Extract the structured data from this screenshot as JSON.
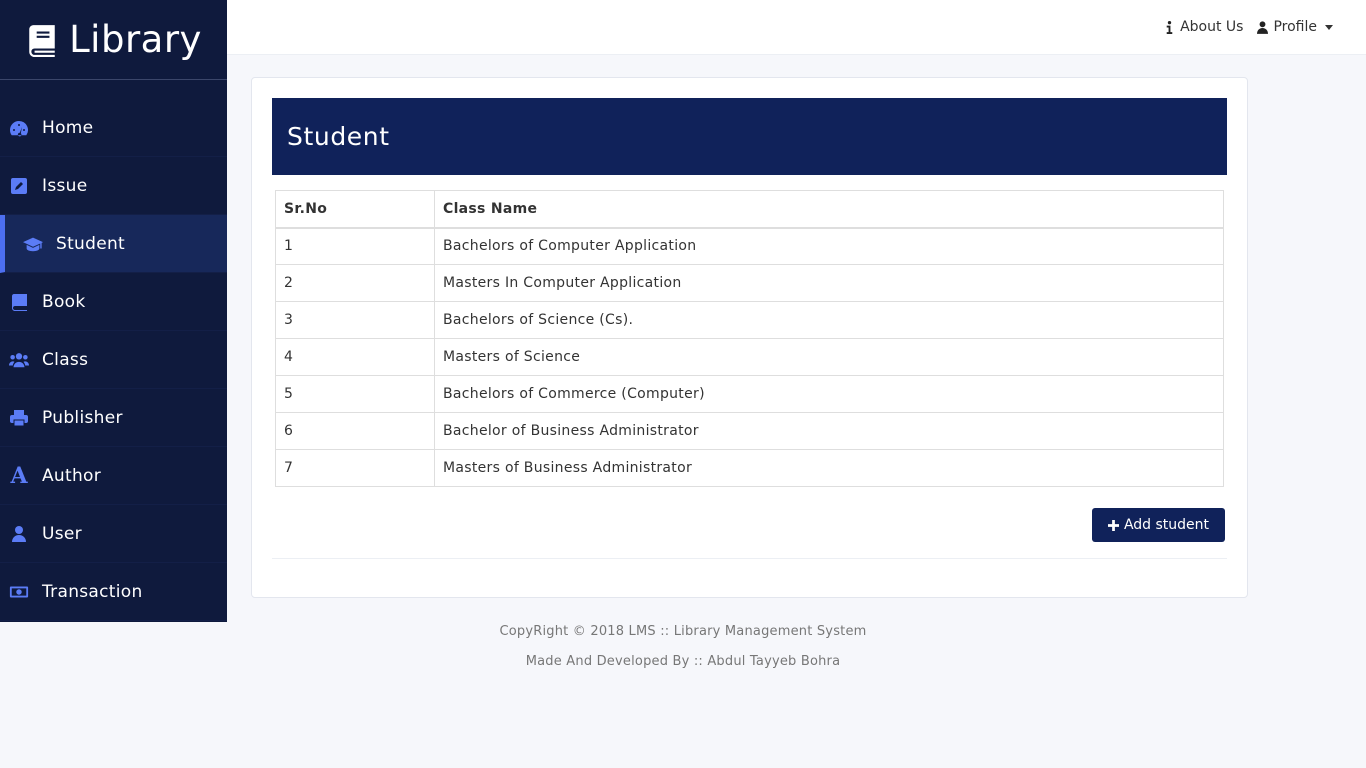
{
  "brand": {
    "title": "Library",
    "icon": "book-icon"
  },
  "sidebar": {
    "items": [
      {
        "label": "Home",
        "icon": "dashboard-icon",
        "active": false
      },
      {
        "label": "Issue",
        "icon": "edit-icon",
        "active": false
      },
      {
        "label": "Student",
        "icon": "graduation-cap-icon",
        "active": true
      },
      {
        "label": "Book",
        "icon": "book-icon",
        "active": false
      },
      {
        "label": "Class",
        "icon": "users-icon",
        "active": false
      },
      {
        "label": "Publisher",
        "icon": "print-icon",
        "active": false
      },
      {
        "label": "Author",
        "icon": "font-icon",
        "active": false
      },
      {
        "label": "User",
        "icon": "user-icon",
        "active": false
      },
      {
        "label": "Transaction",
        "icon": "money-icon",
        "active": false
      }
    ]
  },
  "topbar": {
    "about": "About Us",
    "profile": "Profile"
  },
  "main": {
    "title": "Student",
    "table": {
      "headers": [
        "Sr.No",
        "Class Name"
      ],
      "rows": [
        [
          "1",
          "Bachelors of Computer Application"
        ],
        [
          "2",
          "Masters In Computer Application"
        ],
        [
          "3",
          "Bachelors of Science (Cs)."
        ],
        [
          "4",
          "Masters of Science"
        ],
        [
          "5",
          "Bachelors of Commerce (Computer)"
        ],
        [
          "6",
          "Bachelor of Business Administrator"
        ],
        [
          "7",
          "Masters of Business Administrator"
        ]
      ]
    },
    "add_button": "Add student"
  },
  "footer": {
    "copyright": "CopyRight © 2018 LMS :: Library Management System",
    "developer": "Made And Developed By :: Abdul Tayyeb Bohra"
  },
  "colors": {
    "sidebar_bg": "#0f1a3d",
    "accent": "#10225a",
    "icon_blue": "#5b7cf6"
  }
}
